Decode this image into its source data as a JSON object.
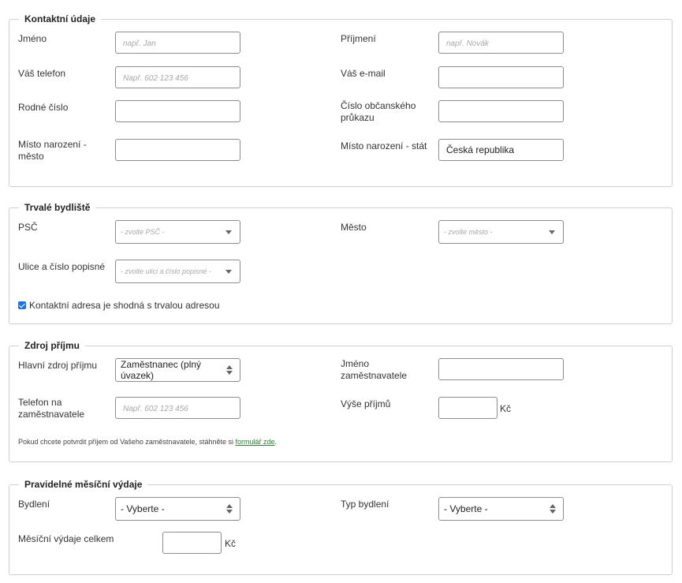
{
  "contact": {
    "legend": "Kontaktní údaje",
    "first_name_label": "Jméno",
    "first_name_placeholder": "např. Jan",
    "last_name_label": "Příjmení",
    "last_name_placeholder": "např. Novák",
    "phone_label": "Váš telefon",
    "phone_placeholder": "Např. 602 123 456",
    "email_label": "Váš e-mail",
    "birth_number_label": "Rodné číslo",
    "id_card_label_line1": "Číslo občanského",
    "id_card_label_line2": "průkazu",
    "birth_city_label_line1": "Místo narození -",
    "birth_city_label_line2": "město",
    "birth_country_label": "Místo narození - stát",
    "birth_country_value": "Česká republika"
  },
  "address": {
    "legend": "Trvalé bydliště",
    "zip_label": "PSČ",
    "zip_placeholder": "- zvolte PSČ -",
    "city_label": "Město",
    "city_placeholder": "- zvolte město -",
    "street_label": "Ulice a číslo popisné",
    "street_placeholder": "- zvolte ulici a číslo popisné -",
    "same_address_label": "Kontaktní adresa je shodná s trvalou adresou"
  },
  "income": {
    "legend": "Zdroj příjmu",
    "main_source_label": "Hlavní zdroj příjmu",
    "main_source_value": "Zaměstnanec (plný úvazek)",
    "employer_name_label_line1": "Jméno",
    "employer_name_label_line2": "zaměstnavatele",
    "employer_phone_label_line1": "Telefon na",
    "employer_phone_label_line2": "zaměstnavatele",
    "employer_phone_placeholder": "Např. 602 123 456",
    "income_amount_label": "Výše příjmů",
    "currency": "Kč",
    "note_text": "Pokud chcete potvrdit příjem od Vašeho zaměstnavatele, stáhněte si ",
    "note_link": "formulář zde",
    "note_end": "."
  },
  "expenses": {
    "legend": "Pravidelné měsíční výdaje",
    "housing_label": "Bydlení",
    "housing_value": "- Vyberte -",
    "housing_type_label": "Typ bydlení",
    "housing_type_value": "- Vyberte -",
    "total_label": "Měsíční výdaje celkem",
    "currency": "Kč"
  }
}
